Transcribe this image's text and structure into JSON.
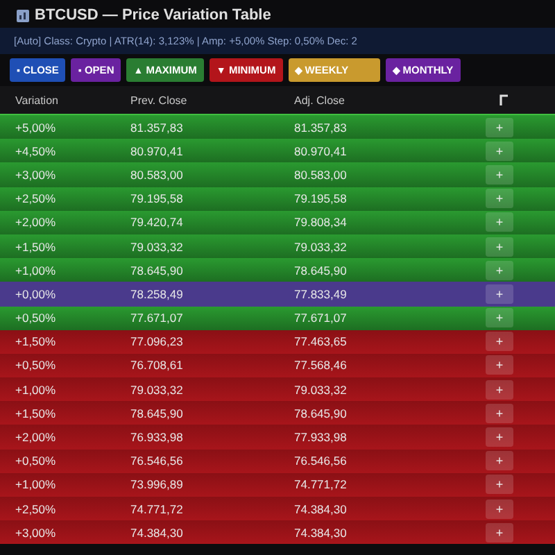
{
  "window": {
    "title": "BTCUSD — Price Variation Table"
  },
  "info": "[Auto] Class: Crypto | ATR(14): 3,123% | Amp: +5,00% Step: 0,50% Dec: 2",
  "buttons": [
    {
      "icon": "▪",
      "label": "CLOSE",
      "color": "#1f4fb5"
    },
    {
      "icon": "▪",
      "label": "OPEN",
      "color": "#6a22a0"
    },
    {
      "icon": "▲",
      "label": "MAXIMUM",
      "color": "#2a7d32"
    },
    {
      "icon": "▼",
      "label": "MINIMUM",
      "color": "#b3151b"
    },
    {
      "icon": "◆",
      "label": "WEEKLY",
      "color": "#c99a2e"
    },
    {
      "icon": "◆",
      "label": "MONTHLY",
      "color": "#6a22a0"
    }
  ],
  "table": {
    "columns": [
      "Variation",
      "Prev. Close",
      "Adj. Close"
    ],
    "rows": [
      {
        "kind": "up",
        "cells": [
          "+5,00%",
          "81.357,83",
          "81.357,83"
        ],
        "action": "+"
      },
      {
        "kind": "up",
        "cells": [
          "+4,50%",
          "80.970,41",
          "80.970,41"
        ],
        "action": "+"
      },
      {
        "kind": "up",
        "cells": [
          "+3,00%",
          "80.583,00",
          "80.583,00"
        ],
        "action": "+"
      },
      {
        "kind": "up",
        "cells": [
          "+2,50%",
          "79.195,58",
          "79.195,58"
        ],
        "action": "+"
      },
      {
        "kind": "up",
        "cells": [
          "+2,00%",
          "79.420,74",
          "79.808,34"
        ],
        "action": "+"
      },
      {
        "kind": "up",
        "cells": [
          "+1,50%",
          "79.033,32",
          "79.033,32"
        ],
        "action": "+"
      },
      {
        "kind": "up",
        "cells": [
          "+1,00%",
          "78.645,90",
          "78.645,90"
        ],
        "action": "+"
      },
      {
        "kind": "current",
        "cells": [
          "+0,00%",
          "78.258,49",
          "77.833,49"
        ],
        "action": "+"
      },
      {
        "kind": "up",
        "cells": [
          "+0,50%",
          "77.671,07",
          "77.671,07"
        ],
        "action": "+"
      },
      {
        "kind": "down",
        "cells": [
          "+1,50%",
          "77.096,23",
          "77.463,65"
        ],
        "action": "+"
      },
      {
        "kind": "down",
        "cells": [
          "+0,50%",
          "76.708,61",
          "77.568,46"
        ],
        "action": "+"
      },
      {
        "kind": "down",
        "cells": [
          "+1,00%",
          "79.033,32",
          "79.033,32"
        ],
        "action": "+"
      },
      {
        "kind": "down",
        "cells": [
          "+1,50%",
          "78.645,90",
          "78.645,90"
        ],
        "action": "+"
      },
      {
        "kind": "down",
        "cells": [
          "+2,00%",
          "76.933,98",
          "77.933,98"
        ],
        "action": "+"
      },
      {
        "kind": "down",
        "cells": [
          "+0,50%",
          "76.546,56",
          "76.546,56"
        ],
        "action": "+"
      },
      {
        "kind": "down",
        "cells": [
          "+1,00%",
          "73.996,89",
          "74.771,72"
        ],
        "action": "+"
      },
      {
        "kind": "down",
        "cells": [
          "+2,50%",
          "74.771,72",
          "74.384,30"
        ],
        "action": "+"
      },
      {
        "kind": "down",
        "cells": [
          "+3,00%",
          "74.384,30",
          "74.384,30"
        ],
        "action": "+"
      }
    ]
  }
}
